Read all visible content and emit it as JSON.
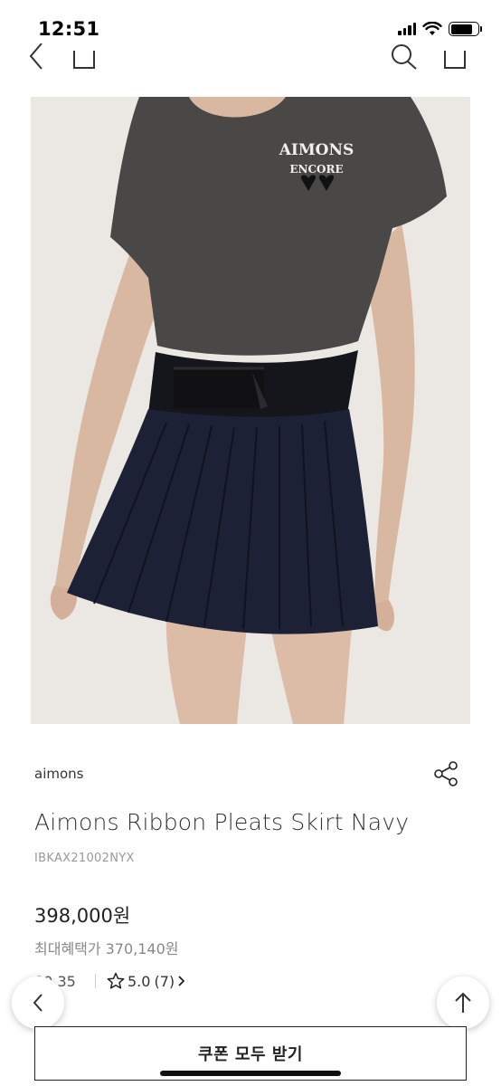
{
  "status_bar": {
    "time": "12:51"
  },
  "nav": {
    "icons": [
      "back-chevron-icon",
      "home-icon",
      "search-icon",
      "cart-icon"
    ]
  },
  "product": {
    "image_alt": "Model wearing navy pleated skirt",
    "shirt_print_line1": "AIMONS",
    "shirt_print_line2": "ENCORE",
    "brand": "aimons",
    "title": "Aimons Ribbon Pleats Skirt Navy",
    "code": "IBKAX21002NYX",
    "price": "398,000원",
    "max_benefit_label": "최대혜택가",
    "max_benefit_price": "370,140원",
    "partial_left_text": "00 35",
    "rating": "5.0",
    "review_count": "(7)"
  },
  "actions": {
    "coupon_label": "쿠폰 모두 받기"
  },
  "colors": {
    "skirt": "#1c2135",
    "shirt": "#4a4846",
    "background": "#ebe8e3"
  }
}
